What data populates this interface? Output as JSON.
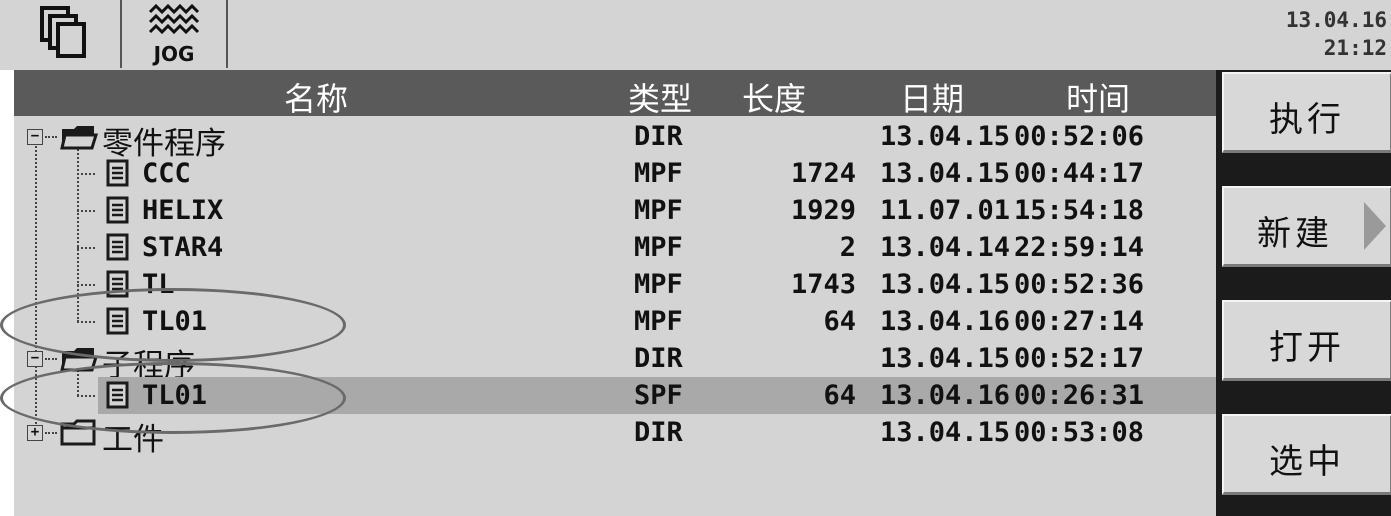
{
  "topbar": {
    "buttons": [
      {
        "icon": "window-stack-icon"
      },
      {
        "icon": "jog-wave-icon",
        "label": "JOG"
      }
    ],
    "clock": {
      "date": "13.04.16",
      "time": "21:12"
    }
  },
  "table": {
    "headers": {
      "name": "名称",
      "type": "类型",
      "length": "长度",
      "date": "日期",
      "time": "时间"
    },
    "rows": [
      {
        "name": "零件程序",
        "type": "DIR",
        "length": "",
        "date": "13.04.15",
        "time": "00:52:06",
        "kind": "folder-open",
        "expander": "−",
        "level": 0
      },
      {
        "name": "CCC",
        "type": "MPF",
        "length": "1724",
        "date": "13.04.15",
        "time": "00:44:17",
        "kind": "file",
        "level": 1
      },
      {
        "name": "HELIX",
        "type": "MPF",
        "length": "1929",
        "date": "11.07.01",
        "time": "15:54:18",
        "kind": "file",
        "level": 1
      },
      {
        "name": "STAR4",
        "type": "MPF",
        "length": "2",
        "date": "13.04.14",
        "time": "22:59:14",
        "kind": "file",
        "level": 1
      },
      {
        "name": "TL",
        "type": "MPF",
        "length": "1743",
        "date": "13.04.15",
        "time": "00:52:36",
        "kind": "file",
        "level": 1
      },
      {
        "name": "TL01",
        "type": "MPF",
        "length": "64",
        "date": "13.04.16",
        "time": "00:27:14",
        "kind": "file",
        "level": 1
      },
      {
        "name": "子程序",
        "type": "DIR",
        "length": "",
        "date": "13.04.15",
        "time": "00:52:17",
        "kind": "folder-open",
        "expander": "−",
        "level": 0
      },
      {
        "name": "TL01",
        "type": "SPF",
        "length": "64",
        "date": "13.04.16",
        "time": "00:26:31",
        "kind": "file",
        "level": 1,
        "selected": true
      },
      {
        "name": "工件",
        "type": "DIR",
        "length": "",
        "date": "13.04.15",
        "time": "00:53:08",
        "kind": "folder-closed",
        "expander": "+",
        "level": 0
      }
    ]
  },
  "softkeys": [
    {
      "label": "执行"
    },
    {
      "label": "新建",
      "has_arrow": true
    },
    {
      "label": "打开"
    },
    {
      "label": "选中"
    }
  ],
  "colors": {
    "header_bg": "#5a5a5a",
    "selection_bg": "#a9a9a9",
    "panel_bg": "#d4d4d4",
    "softkey_bar_bg": "#1b1b1b"
  }
}
